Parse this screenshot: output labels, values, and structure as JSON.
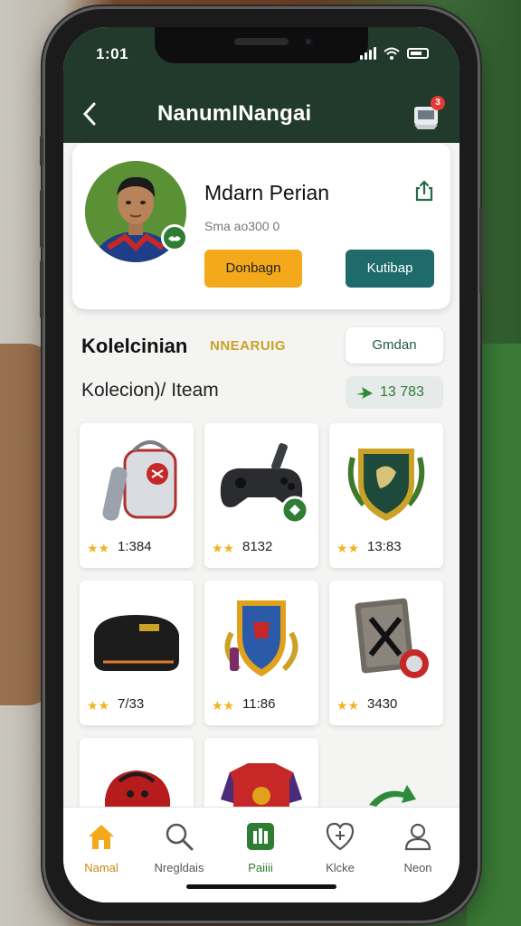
{
  "status_bar": {
    "time": "1:01"
  },
  "header": {
    "title": "NanumINangai",
    "cart_badge": "3"
  },
  "profile": {
    "name": "Mdarn Perian",
    "subtitle": "Sma ao300 0",
    "primary_button": "Donbagn",
    "secondary_button": "Kutibap"
  },
  "section": {
    "title": "Kolelcinian",
    "tag": "NNEARUIG",
    "action_button": "Gmdan",
    "subtitle": "Kolecion)/ Iteam",
    "score": "13 783"
  },
  "items": [
    {
      "icon": "backpack-icon",
      "value": "1:384",
      "stars": "★★"
    },
    {
      "icon": "game-controller-icon",
      "value": "8132",
      "stars": "★★"
    },
    {
      "icon": "crest-badge-icon",
      "value": "13:83",
      "stars": "★★"
    },
    {
      "icon": "duffel-bag-icon",
      "value": "7/33",
      "stars": "★★"
    },
    {
      "icon": "shield-emblem-icon",
      "value": "11:86",
      "stars": "★★"
    },
    {
      "icon": "sports-card-icon",
      "value": "3430",
      "stars": "★★"
    },
    {
      "icon": "red-backpack-icon",
      "value": "",
      "stars": ""
    },
    {
      "icon": "jersey-icon",
      "value": "",
      "stars": ""
    }
  ],
  "nav": [
    {
      "label": "Namal",
      "icon": "home-icon",
      "active": true,
      "color": "#f4a91b"
    },
    {
      "label": "Nregldais",
      "icon": "search-icon",
      "active": false
    },
    {
      "label": "Paiiii",
      "icon": "stats-icon",
      "active": false,
      "color": "#2e7d32"
    },
    {
      "label": "Klcke",
      "icon": "heart-shield-icon",
      "active": false
    },
    {
      "label": "Neon",
      "icon": "profile-icon",
      "active": false
    }
  ]
}
